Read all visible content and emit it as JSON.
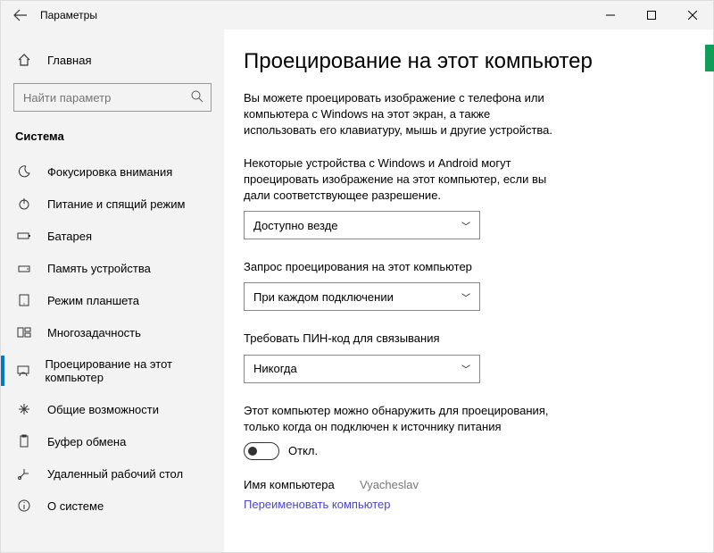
{
  "titlebar": {
    "title": "Параметры"
  },
  "sidebar": {
    "home": "Главная",
    "search_placeholder": "Найти параметр",
    "section": "Система",
    "items": [
      {
        "label": "Фокусировка внимания"
      },
      {
        "label": "Питание и спящий режим"
      },
      {
        "label": "Батарея"
      },
      {
        "label": "Память устройства"
      },
      {
        "label": "Режим планшета"
      },
      {
        "label": "Многозадачность"
      },
      {
        "label": "Проецирование на этот компьютер"
      },
      {
        "label": "Общие возможности"
      },
      {
        "label": "Буфер обмена"
      },
      {
        "label": "Удаленный рабочий стол"
      },
      {
        "label": "О системе"
      }
    ]
  },
  "main": {
    "heading": "Проецирование на этот компьютер",
    "intro": "Вы можете проецировать изображение с телефона или компьютера с Windows на этот экран, а также использовать его клавиатуру, мышь и другие устройства.",
    "permission_text": "Некоторые устройства с Windows и Android могут проецировать изображение на этот компьютер, если вы дали соответствующее разрешение.",
    "select_availability": "Доступно везде",
    "label_request": "Запрос проецирования на этот компьютер",
    "select_request": "При каждом подключении",
    "label_pin": "Требовать ПИН-код для связывания",
    "select_pin": "Никогда",
    "power_text": "Этот компьютер можно обнаружить для проецирования, только когда он подключен к источнику питания",
    "toggle_state": "Откл.",
    "pc_name_label": "Имя компьютера",
    "pc_name_value": "Vyacheslav",
    "rename_link": "Переименовать компьютер"
  }
}
